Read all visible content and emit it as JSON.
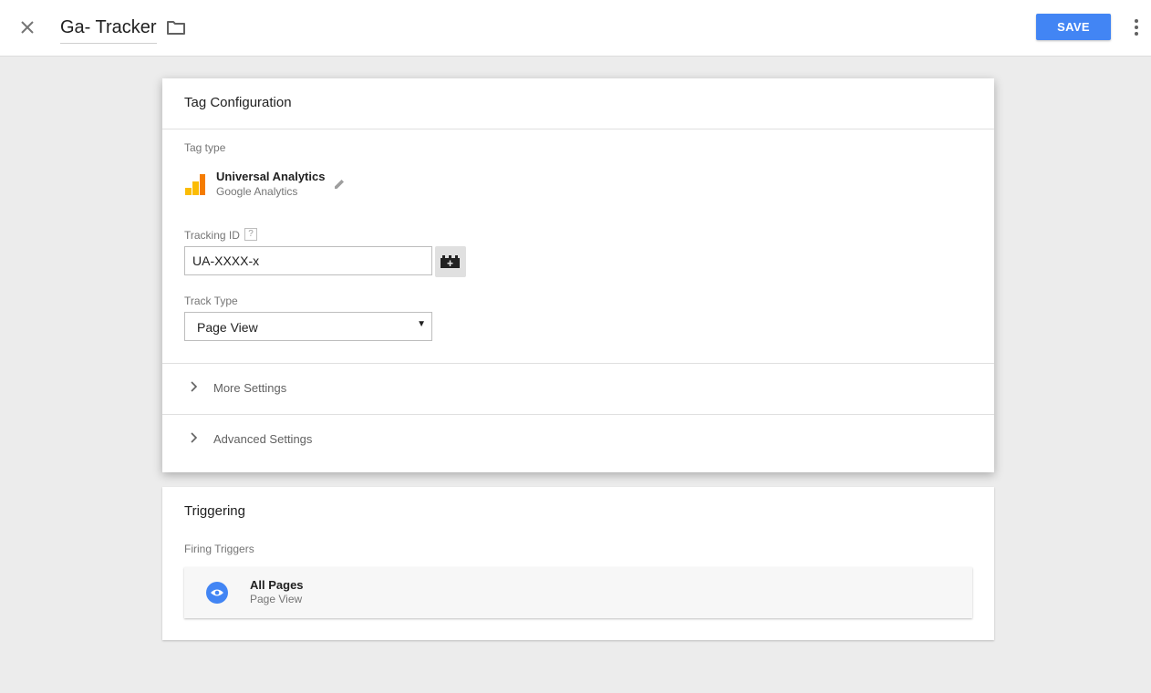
{
  "header": {
    "title": "Ga- Tracker",
    "save_label": "SAVE",
    "icons": {
      "close": "close-icon",
      "folder": "folder-icon",
      "more": "more-vert-icon"
    },
    "accent_color": "#4285f4"
  },
  "tag_configuration": {
    "title": "Tag Configuration",
    "tag_type_label": "Tag type",
    "tag_type": {
      "name": "Universal Analytics",
      "provider": "Google Analytics",
      "icon": "universal-analytics-icon"
    },
    "tracking_id": {
      "label": "Tracking ID",
      "help": "?",
      "value": "UA-XXXX-x"
    },
    "track_type": {
      "label": "Track Type",
      "selected": "Page View"
    },
    "sections": [
      {
        "label": "More Settings"
      },
      {
        "label": "Advanced Settings"
      }
    ]
  },
  "triggering": {
    "title": "Triggering",
    "firing_label": "Firing Triggers",
    "triggers": [
      {
        "name": "All Pages",
        "type": "Page View",
        "icon": "eye-icon"
      }
    ]
  }
}
